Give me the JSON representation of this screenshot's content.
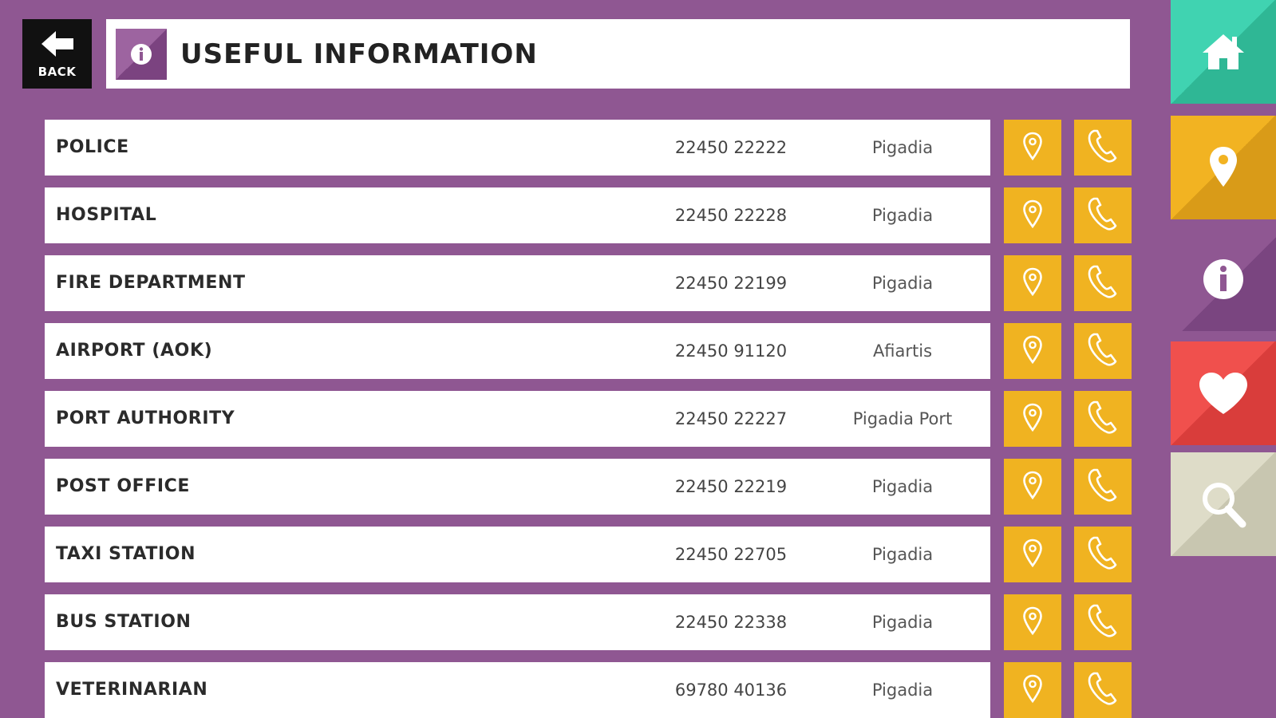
{
  "header": {
    "back_label": "BACK",
    "title": "USEFUL INFORMATION"
  },
  "entries": [
    {
      "name": "POLICE",
      "phone": "22450 22222",
      "place": "Pigadia"
    },
    {
      "name": "HOSPITAL",
      "phone": "22450 22228",
      "place": "Pigadia"
    },
    {
      "name": "FIRE DEPARTMENT",
      "phone": "22450 22199",
      "place": "Pigadia"
    },
    {
      "name": "AIRPORT (AOK)",
      "phone": "22450 91120",
      "place": "Afiartis"
    },
    {
      "name": "PORT AUTHORITY",
      "phone": "22450 22227",
      "place": "Pigadia Port"
    },
    {
      "name": "POST OFFICE",
      "phone": "22450 22219",
      "place": "Pigadia"
    },
    {
      "name": "TAXI STATION",
      "phone": "22450 22705",
      "place": "Pigadia"
    },
    {
      "name": "BUS STATION",
      "phone": "22450 22338",
      "place": "Pigadia"
    },
    {
      "name": "VETERINARIAN",
      "phone": "69780 40136",
      "place": "Pigadia"
    }
  ],
  "nav": [
    "home-icon",
    "map-pin-icon",
    "info-icon",
    "heart-icon",
    "search-icon"
  ],
  "colors": {
    "background": "#8f5792",
    "action_button": "#f0b321",
    "nav_home": "#40d3b1",
    "nav_map": "#f2b322",
    "nav_favorites": "#f0504d",
    "nav_search": "#dedcc8"
  }
}
